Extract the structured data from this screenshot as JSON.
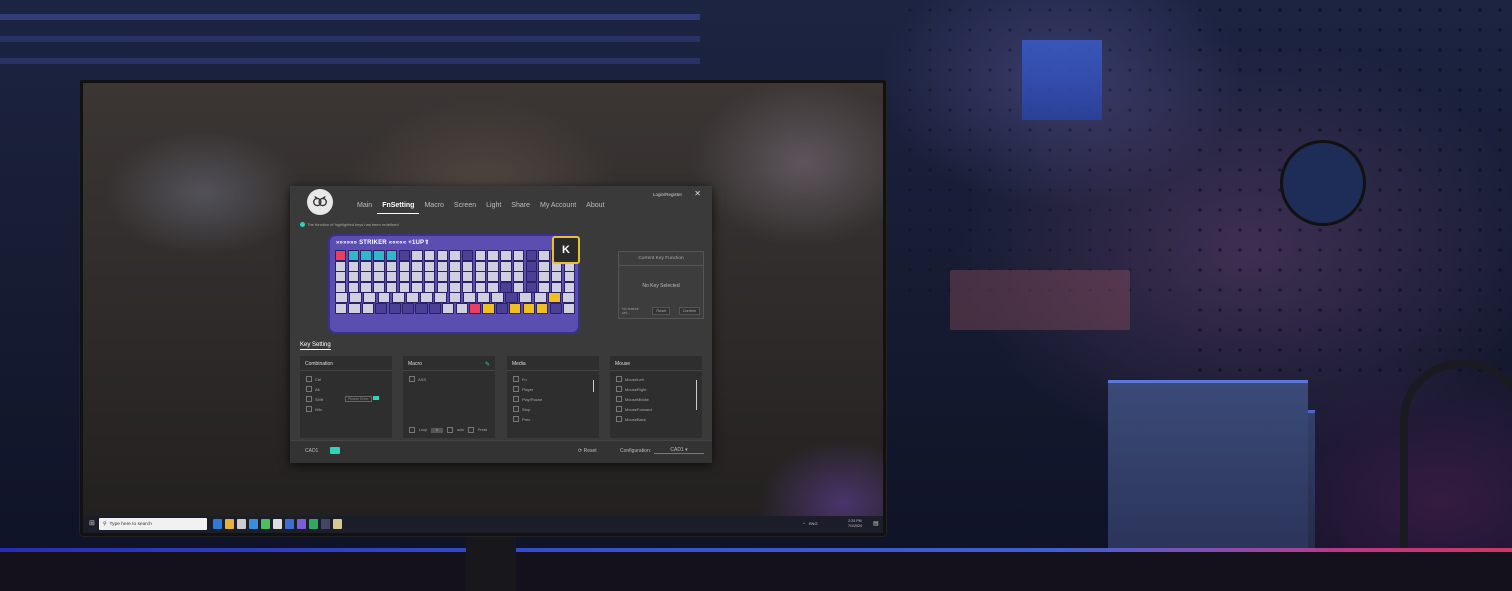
{
  "app": {
    "header": {
      "login": "Login/Register",
      "close_glyph": "✕",
      "logo_icon": "owl-logo-icon"
    },
    "nav": [
      {
        "label": "Main",
        "active": false
      },
      {
        "label": "FnSetting",
        "active": true
      },
      {
        "label": "Macro",
        "active": false
      },
      {
        "label": "Screen",
        "active": false
      },
      {
        "label": "Light",
        "active": false
      },
      {
        "label": "Share",
        "active": false
      },
      {
        "label": "My Account",
        "active": false
      },
      {
        "label": "About",
        "active": false
      }
    ],
    "notice": "The function of highlighted keys has been redefined",
    "keyboard": {
      "label": "»»»»»» STRIKER ««««« +1UP⇑"
    },
    "current_key": {
      "title": "Current Key Function",
      "body": "No Key Selected",
      "no_feature": "No feature set...",
      "reset": "Reset",
      "confirm": "Confirm"
    },
    "key_setting": {
      "title": "Key Setting",
      "combination": {
        "title": "Combination",
        "options": [
          "Ctrl",
          "Alt",
          "Shift",
          "Win"
        ],
        "placeholder": "Please Enter"
      },
      "macro": {
        "title": "Macro",
        "options": [
          "ASS"
        ],
        "loop": "Loop",
        "loop_value": "1",
        "auto": "auto",
        "press": "Press"
      },
      "media": {
        "title": "Media",
        "options": [
          "Fn",
          "Player",
          "Play/Pause",
          "Stop",
          "Prev"
        ]
      },
      "mouse": {
        "title": "Mouse",
        "options": [
          "MouseLeft",
          "MouseRight",
          "MouseMiddle",
          "MouseForward",
          "MouseBack"
        ]
      }
    },
    "footer": {
      "device": "CAD1",
      "reset": "Reset",
      "configuration_label": "Configuration:",
      "configuration_value": "CAD1"
    }
  },
  "taskbar": {
    "search_placeholder": "Type here to search",
    "tray": [
      "ENG"
    ],
    "time": "2:25 PM",
    "date": "7/1/2024"
  }
}
